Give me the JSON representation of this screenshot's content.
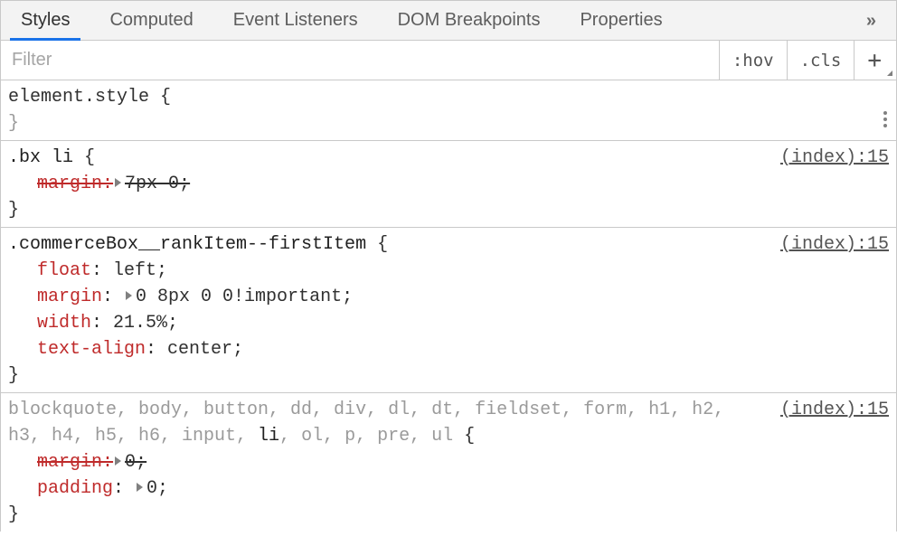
{
  "tabs": {
    "items": [
      "Styles",
      "Computed",
      "Event Listeners",
      "DOM Breakpoints",
      "Properties"
    ],
    "active_index": 0,
    "overflow_glyph": "»"
  },
  "filter": {
    "placeholder": "Filter",
    "hov_label": ":hov",
    "cls_label": ".cls",
    "plus_label": "+"
  },
  "rules": {
    "element_style": {
      "selector": "element.style",
      "open_brace": " {",
      "close_brace": "}"
    },
    "r1": {
      "selector": ".bx li",
      "open_brace": " {",
      "source": "(index):15",
      "d0_prop": "margin",
      "d0_val": "7px 0",
      "close_brace": "}"
    },
    "r2": {
      "selector": ".commerceBox__rankItem--firstItem",
      "open_brace": " {",
      "source": "(index):15",
      "d0_prop": "float",
      "d0_val": "left",
      "d1_prop": "margin",
      "d1_val": "0 8px 0 0!important",
      "d2_prop": "width",
      "d2_val": "21.5%",
      "d3_prop": "text-align",
      "d3_val": "center",
      "close_brace": "}"
    },
    "r3": {
      "sel_gray1": "blockquote, body, button, dd, div, dl, dt, fieldset, form, h1, h2, h3, h4, h5, h6, input, ",
      "sel_hit": "li",
      "sel_gray2": ", ol, p, pre, ul",
      "open_brace": " {",
      "source": "(index):15",
      "d0_prop": "margin",
      "d0_val": "0",
      "d1_prop": "padding",
      "d1_val": "0",
      "close_brace": "}"
    }
  }
}
